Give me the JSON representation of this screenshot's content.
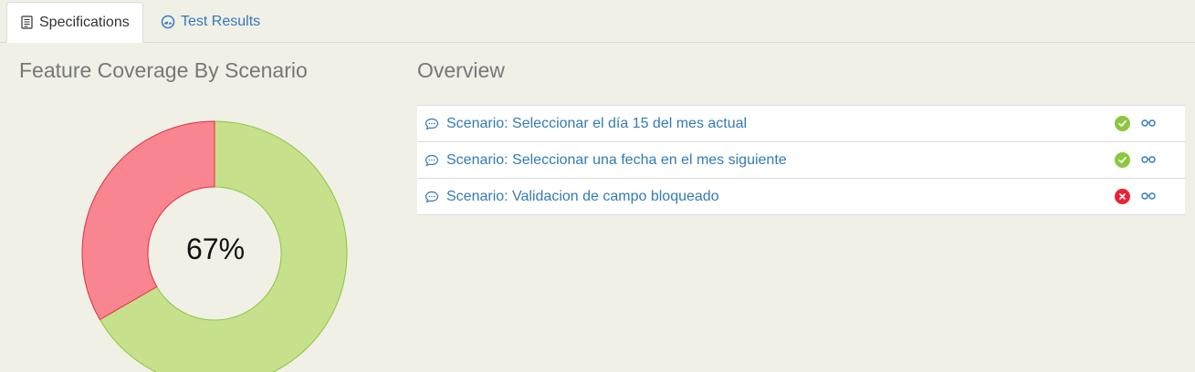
{
  "tabs": [
    {
      "label": "Specifications",
      "icon": "document-list-icon",
      "active": true
    },
    {
      "label": "Test Results",
      "icon": "dashboard-gauge-icon",
      "active": false
    }
  ],
  "left_panel": {
    "title": "Feature Coverage By Scenario"
  },
  "right_panel": {
    "title": "Overview"
  },
  "chart_data": {
    "type": "pie",
    "style": "donut",
    "center_label": "67%",
    "slices": [
      {
        "status": "passed",
        "value": 2,
        "color": "#c6e08c",
        "border": "#8cc63f"
      },
      {
        "status": "failed",
        "value": 1,
        "color": "#f8858f",
        "border": "#e0303c"
      }
    ]
  },
  "scenarios": [
    {
      "label": "Scenario: Seleccionar el día 15 del mes actual",
      "status": "passed"
    },
    {
      "label": "Scenario: Seleccionar una fecha en el mes siguiente",
      "status": "passed"
    },
    {
      "label": "Scenario: Validacion de campo bloqueado",
      "status": "failed"
    }
  ],
  "colors": {
    "passed": "#8dc63f",
    "failed": "#e8233a",
    "link": "#337ab7"
  }
}
